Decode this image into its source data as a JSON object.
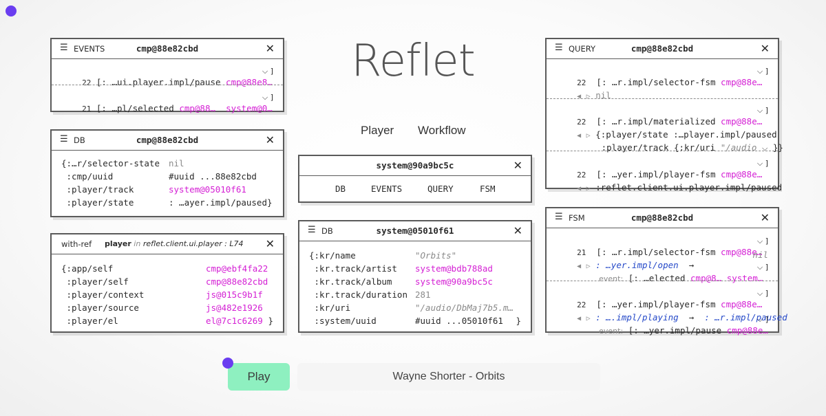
{
  "title": "Reflet",
  "nav": [
    "Player",
    "Workflow"
  ],
  "events_panel": {
    "kind": "EVENTS",
    "id": "cmp@88e82cbd",
    "rows": [
      {
        "n": "22",
        "text": "[: …ui.player.impl/pause",
        "ref": "cmp@88e8…",
        "ref2": ""
      },
      {
        "n": "21",
        "text": "[: …pl/selected",
        "ref": "cmp@88…",
        "ref2": "system@0…"
      }
    ]
  },
  "db_panel_left": {
    "kind": "DB",
    "id": "cmp@88e82cbd",
    "rows": [
      {
        "k": "{:…r/selector-state",
        "v": "nil"
      },
      {
        "k": " :cmp/uuid",
        "v": "#uuid ...88e82cbd"
      },
      {
        "k": " :player/track",
        "v": "system@05010f61"
      },
      {
        "k": " :player/state",
        "v": ": …ayer.impl/paused}"
      }
    ]
  },
  "withref_panel": {
    "kind": "with-ref",
    "label": "player",
    "in_word": "in",
    "ns": "reflet.client.ui.player",
    "line": "L74",
    "rows": [
      {
        "k": "{:app/self",
        "v": "cmp@ebf4fa22"
      },
      {
        "k": " :player/self",
        "v": "cmp@88e82cbd"
      },
      {
        "k": " :player/context",
        "v": "js@015c9b1f"
      },
      {
        "k": " :player/source",
        "v": "js@482e1926"
      },
      {
        "k": " :player/el",
        "v": "el@7c1c6269"
      }
    ],
    "close_brace": "}"
  },
  "system_panel": {
    "id": "system@90a9bc5c",
    "tabs": [
      "DB",
      "EVENTS",
      "QUERY",
      "FSM"
    ]
  },
  "db_panel_center": {
    "kind": "DB",
    "id": "system@05010f61",
    "rows": [
      {
        "k": "{:kr/name",
        "v": "\"Orbits\""
      },
      {
        "k": " :kr.track/artist",
        "v": "system@bdb788ad"
      },
      {
        "k": " :kr.track/album",
        "v": "system@90a9bc5c"
      },
      {
        "k": " :kr.track/duration",
        "v": "281"
      },
      {
        "k": " :kr/uri",
        "v": "\"/audio/DbMaj7b5.m…"
      },
      {
        "k": " :system/uuid",
        "v": "#uuid ...05010f61"
      }
    ],
    "close_brace": "}"
  },
  "query_panel": {
    "kind": "QUERY",
    "id": "cmp@88e82cbd",
    "entries": [
      {
        "n": "22",
        "text": "[: …r.impl/selector-fsm",
        "ref": "cmp@88e…",
        "result": "nil"
      },
      {
        "n": "22",
        "text": "[: …r.impl/materialized",
        "ref": "cmp@88e…",
        "result": "{:player/state :…player.impl/paused",
        "result2": " :player/track {:kr/uri",
        "result2b": "\"/audio",
        "result2c": "}}"
      },
      {
        "n": "22",
        "text": "[: …yer.impl/player-fsm",
        "ref": "cmp@88e…",
        "result": ":reflet.client.ui.player.impl/paused"
      }
    ]
  },
  "fsm_panel": {
    "kind": "FSM",
    "id": "cmp@88e82cbd",
    "entries": [
      {
        "n": "21",
        "text": "[: …r.impl/selector-fsm",
        "ref": "cmp@88e…",
        "from": ": …yer.impl/open",
        "arrow": "→",
        "to": "nil",
        "event_label": "event:",
        "event": "[: …elected",
        "event_ref": "cmp@8…",
        "event_ref2": "system…"
      },
      {
        "n": "22",
        "text": "[: …yer.impl/player-fsm",
        "ref": "cmp@88e…",
        "from": ": ….impl/playing",
        "arrow": "→",
        "to": ": …r.impl/paused",
        "event_label": "event:",
        "event": "[: …yer.impl/pause",
        "event_ref": "cmp@88e…",
        "event_ref2": ""
      }
    ]
  },
  "player_bar": {
    "play_label": "Play",
    "track": "Wayne Shorter - Orbits"
  },
  "colors": {
    "accent": "#6a3df0",
    "ref": "#d41fd4",
    "play_bg": "#8ef0c0",
    "state": "#2448c8"
  }
}
